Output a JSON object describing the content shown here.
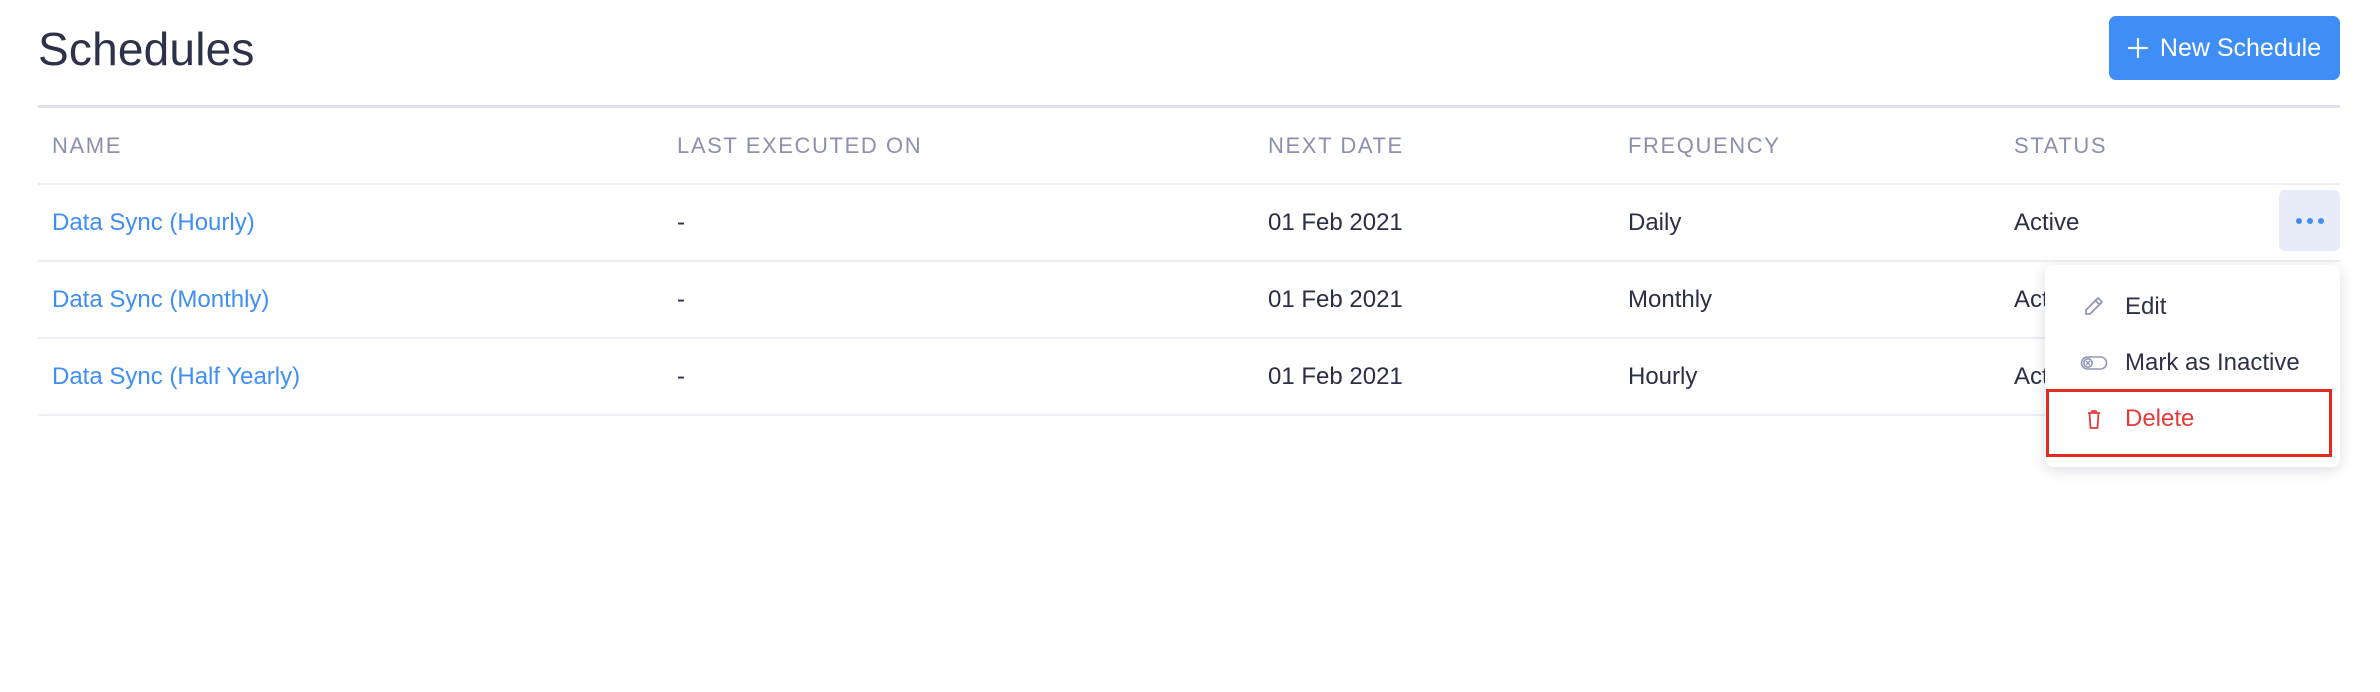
{
  "page": {
    "title": "Schedules",
    "new_button_label": "New Schedule"
  },
  "table": {
    "columns": [
      "NAME",
      "LAST EXECUTED ON",
      "NEXT DATE",
      "FREQUENCY",
      "STATUS"
    ],
    "rows": [
      {
        "name": "Data Sync (Hourly)",
        "last_executed": "-",
        "next_date": "01 Feb 2021",
        "frequency": "Daily",
        "status": "Active"
      },
      {
        "name": "Data Sync (Monthly)",
        "last_executed": "-",
        "next_date": "01 Feb 2021",
        "frequency": "Monthly",
        "status": "Active"
      },
      {
        "name": "Data Sync (Half Yearly)",
        "last_executed": "-",
        "next_date": "01 Feb 2021",
        "frequency": "Hourly",
        "status": "Active"
      }
    ]
  },
  "row_menu": {
    "icon": "more-horizontal-icon",
    "items": [
      {
        "label": "Edit",
        "icon": "pencil-icon"
      },
      {
        "label": "Mark as Inactive",
        "icon": "toggle-off-icon"
      },
      {
        "label": "Delete",
        "icon": "trash-icon"
      }
    ]
  },
  "colors": {
    "accent": "#3f8ef5",
    "danger": "#e63a3a",
    "highlight_box": "#e22a1e"
  }
}
